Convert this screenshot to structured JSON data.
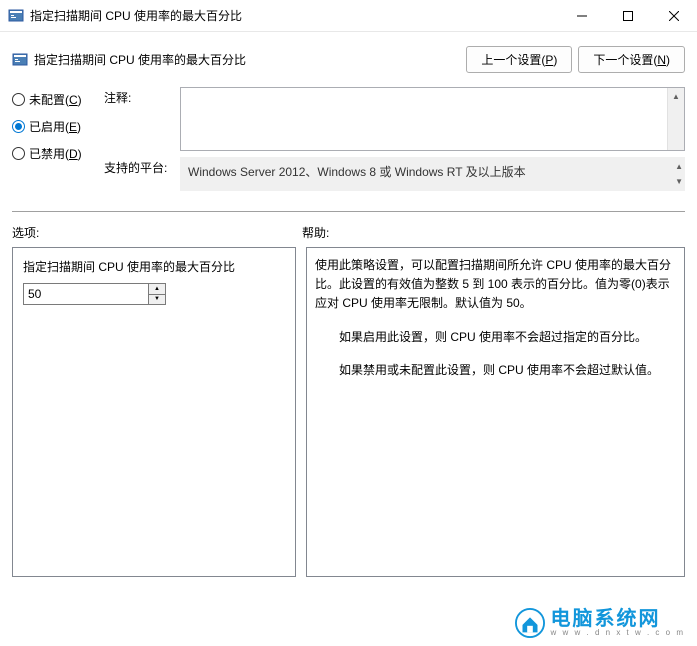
{
  "window": {
    "title": "指定扫描期间 CPU 使用率的最大百分比"
  },
  "header": {
    "title": "指定扫描期间 CPU 使用率的最大百分比",
    "prev_btn_prefix": "上一个设置(",
    "prev_btn_key": "P",
    "prev_btn_suffix": ")",
    "next_btn_prefix": "下一个设置(",
    "next_btn_key": "N",
    "next_btn_suffix": ")"
  },
  "radios": {
    "not_configured_prefix": "未配置(",
    "not_configured_key": "C",
    "not_configured_suffix": ")",
    "enabled_prefix": "已启用(",
    "enabled_key": "E",
    "enabled_suffix": ")",
    "disabled_prefix": "已禁用(",
    "disabled_key": "D",
    "disabled_suffix": ")"
  },
  "fields": {
    "comment_label": "注释:",
    "platform_label": "支持的平台:",
    "platform_text": "Windows Server 2012、Windows 8 或 Windows RT 及以上版本"
  },
  "sections": {
    "options_label": "选项:",
    "help_label": "帮助:"
  },
  "options": {
    "spinner_label": "指定扫描期间 CPU 使用率的最大百分比",
    "spinner_value": "50"
  },
  "help": {
    "p1": "使用此策略设置，可以配置扫描期间所允许 CPU 使用率的最大百分比。此设置的有效值为整数 5 到 100 表示的百分比。值为零(0)表示应对 CPU 使用率无限制。默认值为 50。",
    "p2": "如果启用此设置，则 CPU 使用率不会超过指定的百分比。",
    "p3": "如果禁用或未配置此设置，则 CPU 使用率不会超过默认值。"
  },
  "watermark": {
    "cn": "电脑系统网",
    "en": "w w w . d n x t w . c o m"
  }
}
